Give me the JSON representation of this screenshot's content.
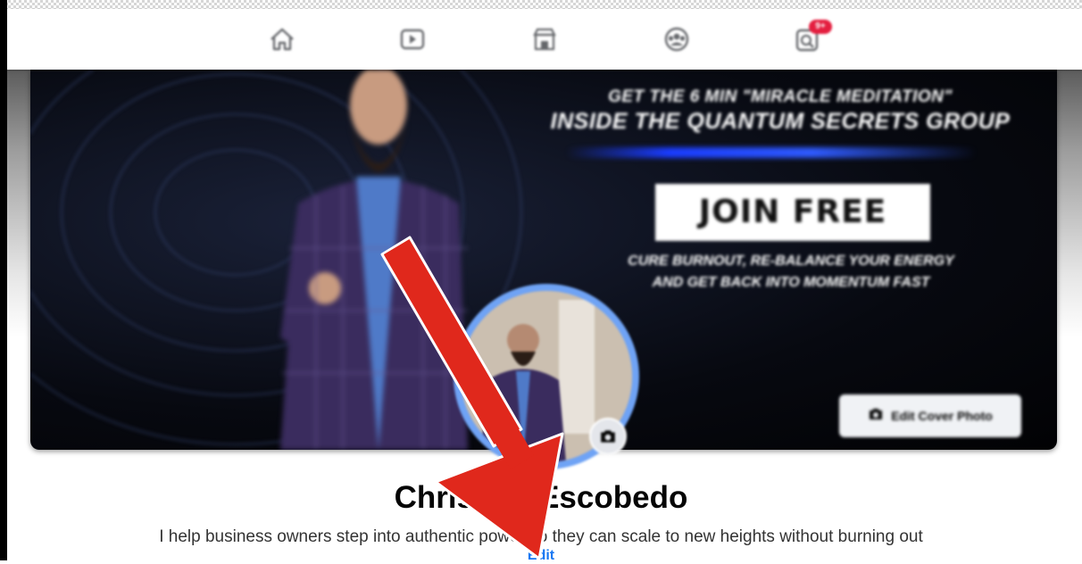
{
  "nav": {
    "items": [
      {
        "name": "home",
        "icon": "home-icon"
      },
      {
        "name": "watch",
        "icon": "video-icon"
      },
      {
        "name": "marketplace",
        "icon": "marketplace-icon"
      },
      {
        "name": "groups",
        "icon": "groups-icon"
      },
      {
        "name": "gaming",
        "icon": "gaming-icon",
        "badge": "9+"
      }
    ]
  },
  "cover": {
    "promo_line1": "GET THE 6 MIN \"MIRACLE MEDITATION\"",
    "promo_line2": "INSIDE THE QUANTUM SECRETS GROUP",
    "join_button": "JOIN FREE",
    "promo_line3": "CURE BURNOUT, RE-BALANCE YOUR ENERGY",
    "promo_line4": "AND GET BACK INTO MOMENTUM FAST",
    "edit_cover_label": "Edit Cover Photo"
  },
  "profile": {
    "name": "Christian Escobedo",
    "bio": "I help business owners step into authentic power so they can scale to new heights without burning out",
    "edit_label": "Edit"
  },
  "colors": {
    "brand_blue": "#1877f2",
    "annotation_red": "#e0281c",
    "badge_red": "#e41e3f"
  }
}
